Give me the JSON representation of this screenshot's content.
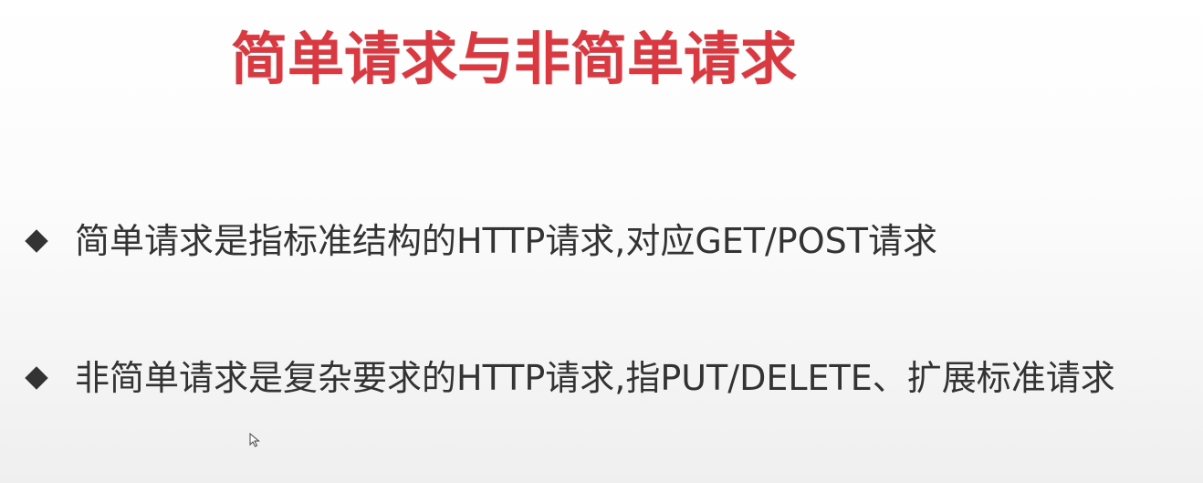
{
  "slide": {
    "title": "简单请求与非简单请求",
    "bullets": [
      {
        "text": "简单请求是指标准结构的HTTP请求,对应GET/POST请求"
      },
      {
        "text": "非简单请求是复杂要求的HTTP请求,指PUT/DELETE、扩展标准请求"
      }
    ]
  },
  "colors": {
    "title": "#d93a41",
    "bullet_text": "#333333",
    "bullet_marker": "#333333"
  },
  "icons": {
    "bullet_marker": "diamond-icon",
    "pointer": "mouse-cursor-icon"
  }
}
